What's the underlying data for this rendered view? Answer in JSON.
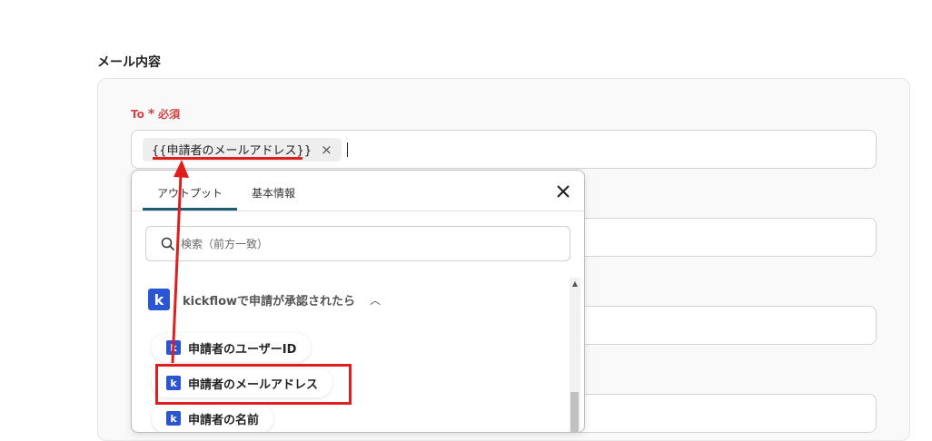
{
  "section": {
    "title": "メール内容"
  },
  "to_field": {
    "label": "To",
    "required_star": "*",
    "required_text": "必須",
    "chip_text": "{{申請者のメールアドレス}}",
    "chip_close": "×"
  },
  "dropdown": {
    "tabs": [
      {
        "label": "アウトプット",
        "active": true
      },
      {
        "label": "基本情報",
        "active": false
      }
    ],
    "close_label": "×",
    "search_placeholder": "検索（前方一致）",
    "group": {
      "title": "kickflowで申請が承認されたら",
      "logo_letter": "k"
    },
    "items": [
      {
        "label": "申請者のユーザーID"
      },
      {
        "label": "申請者のメールアドレス"
      },
      {
        "label": "申請者の名前"
      }
    ]
  },
  "colors": {
    "accent": "#1d5c74",
    "brand": "#2a56d4",
    "annotation": "#e01e1e",
    "required": "#d64545"
  }
}
